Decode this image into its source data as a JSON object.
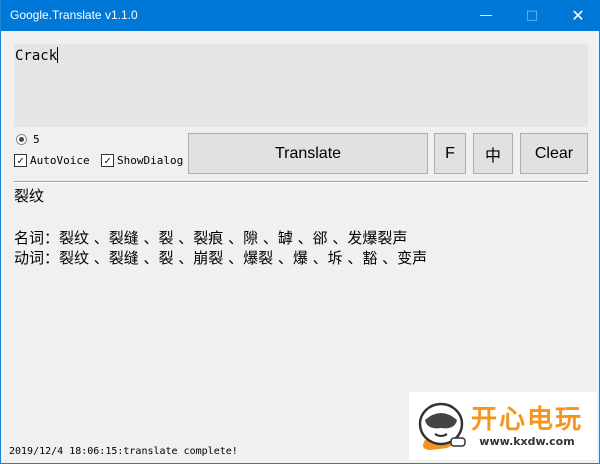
{
  "window": {
    "title": "Google.Translate v1.1.0",
    "accent": "#0078d7"
  },
  "input": {
    "value": "Crack"
  },
  "controls": {
    "radio_label": "5",
    "auto_voice": {
      "label": "AutoVoice",
      "checked": true
    },
    "show_dialog": {
      "label": "ShowDialog",
      "checked": true
    },
    "translate_label": "Translate",
    "f_label": "F",
    "zh_label": "中",
    "clear_label": "Clear"
  },
  "result": {
    "main": "裂纹",
    "noun": "名词：裂纹 、裂缝 、裂 、裂痕 、隙 、罅 、郤 、发爆裂声",
    "verb": "动词：裂纹 、裂缝 、裂 、崩裂 、爆裂 、爆 、坼 、豁 、变声"
  },
  "status": "2019/12/4 18:06:15:translate complete!",
  "watermark": {
    "name": "开心电玩",
    "url": "www.kxdw.com"
  }
}
